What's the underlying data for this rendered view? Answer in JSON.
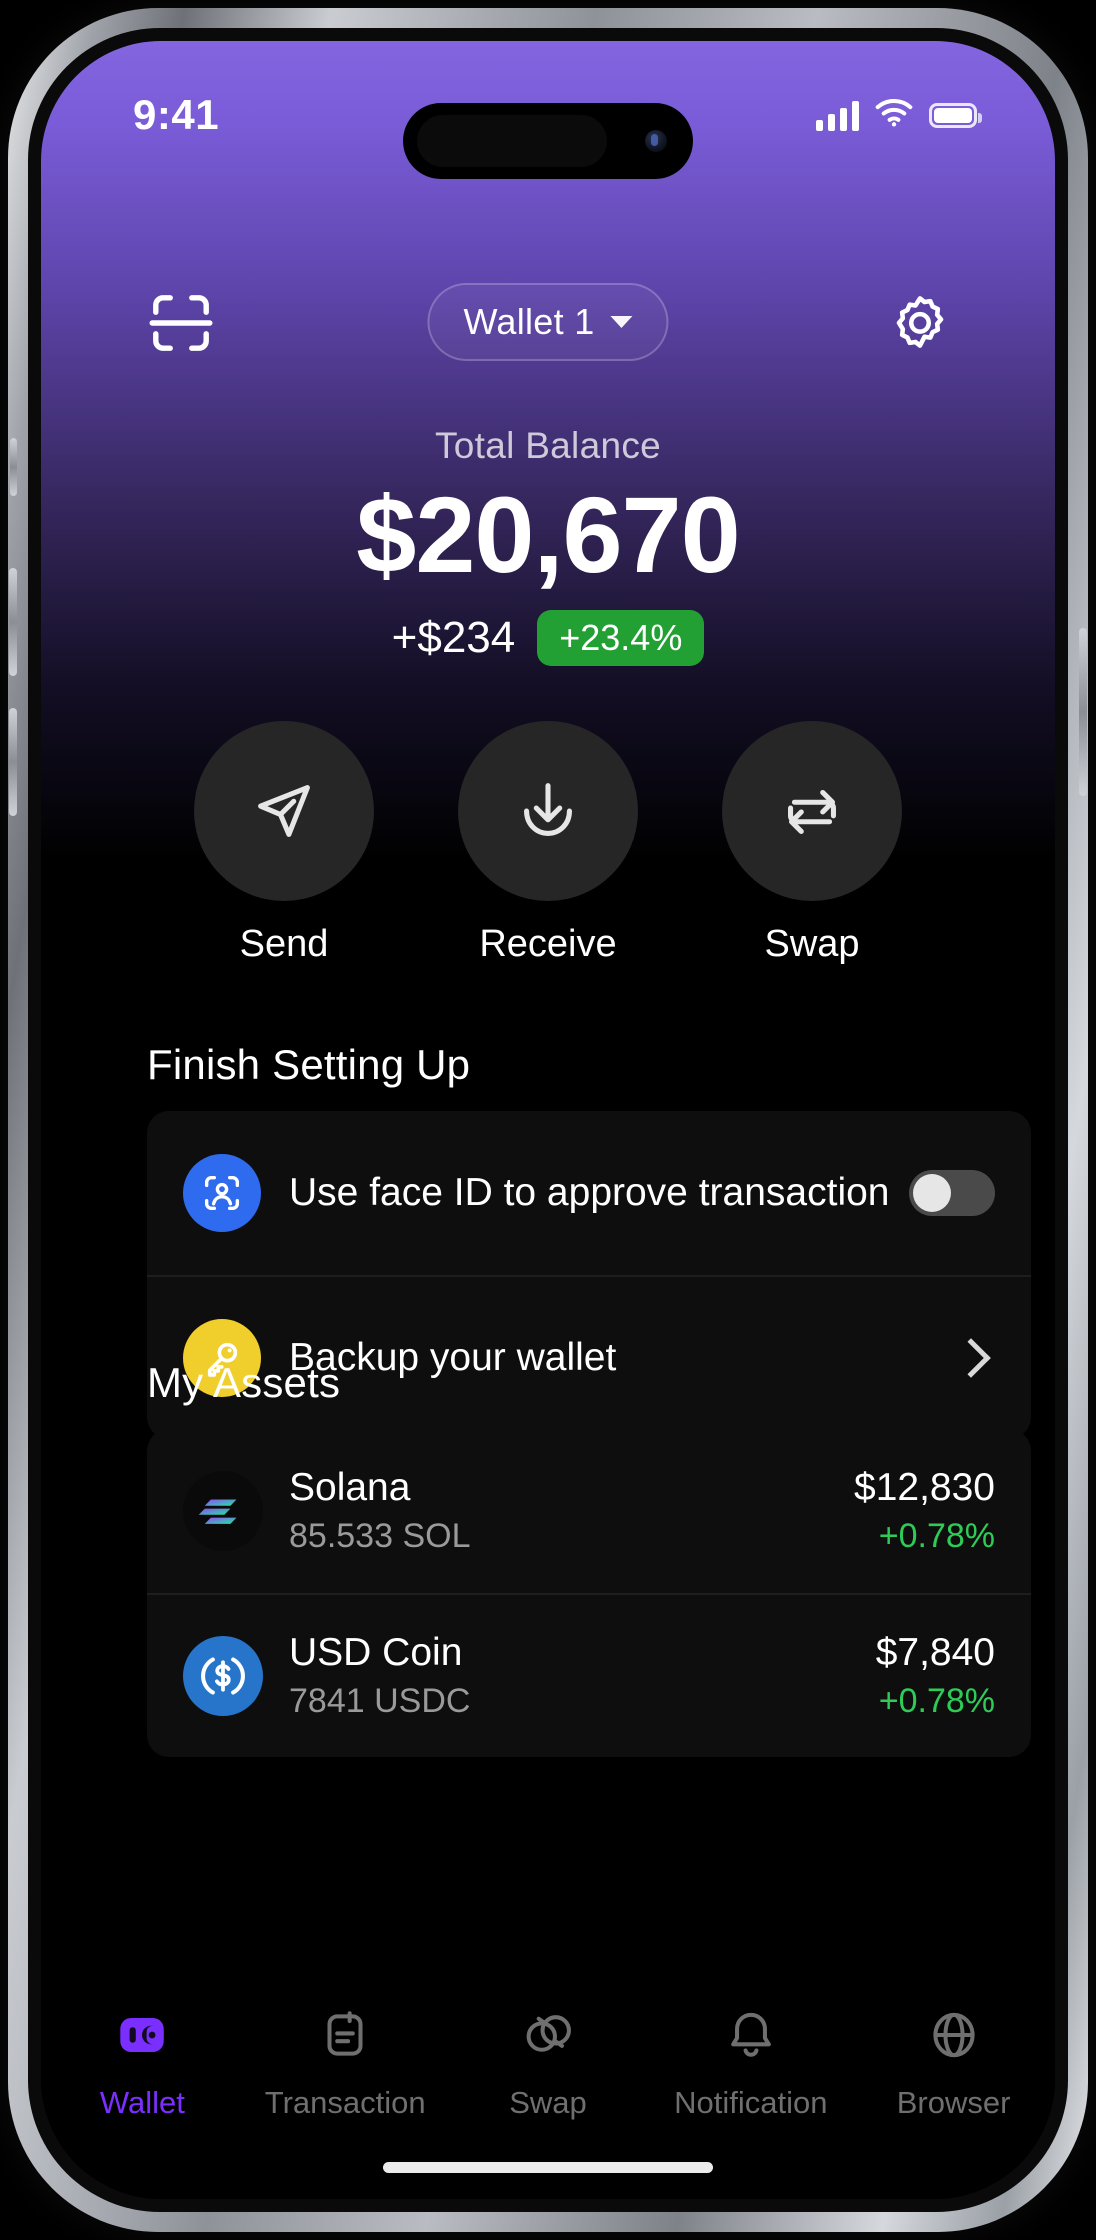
{
  "status_bar": {
    "time": "9:41",
    "icons": [
      "signal-bars",
      "wifi",
      "battery-full"
    ]
  },
  "header": {
    "scan_icon": "scan-icon",
    "wallet_label": "Wallet 1",
    "caret_icon": "chevron-down-icon",
    "settings_icon": "gear-icon"
  },
  "balance": {
    "label": "Total Balance",
    "amount": "$20,670",
    "change_amount": "+$234",
    "change_percent": "+23.4%",
    "badge_color": "#22A033"
  },
  "actions": [
    {
      "label": "Send",
      "icon": "send-icon"
    },
    {
      "label": "Receive",
      "icon": "receive-icon"
    },
    {
      "label": "Swap",
      "icon": "swap-icon"
    }
  ],
  "setup": {
    "title": "Finish Setting Up",
    "rows": [
      {
        "label": "Use face ID to approve transaction",
        "icon": "face-id-icon",
        "icon_color": "#2F6BEE",
        "control": "toggle",
        "toggle_on": false
      },
      {
        "label": "Backup your wallet",
        "icon": "key-icon",
        "icon_color": "#F0CE2B",
        "control": "chevron"
      }
    ]
  },
  "assets": {
    "title": "My Assets",
    "items": [
      {
        "name": "Solana",
        "amount": "85.533 SOL",
        "value": "$12,830",
        "change": "+0.78%",
        "icon": "solana-icon"
      },
      {
        "name": "USD Coin",
        "amount": "7841 USDC",
        "value": "$7,840",
        "change": "+0.78%",
        "icon": "usdc-icon"
      }
    ]
  },
  "tabbar": {
    "active_color": "#7B2FFF",
    "tabs": [
      {
        "label": "Wallet",
        "icon": "wallet-icon",
        "active": true
      },
      {
        "label": "Transaction",
        "icon": "document-icon",
        "active": false
      },
      {
        "label": "Swap",
        "icon": "swap-circles-icon",
        "active": false
      },
      {
        "label": "Notification",
        "icon": "bell-icon",
        "active": false
      },
      {
        "label": "Browser",
        "icon": "globe-icon",
        "active": false
      }
    ]
  }
}
